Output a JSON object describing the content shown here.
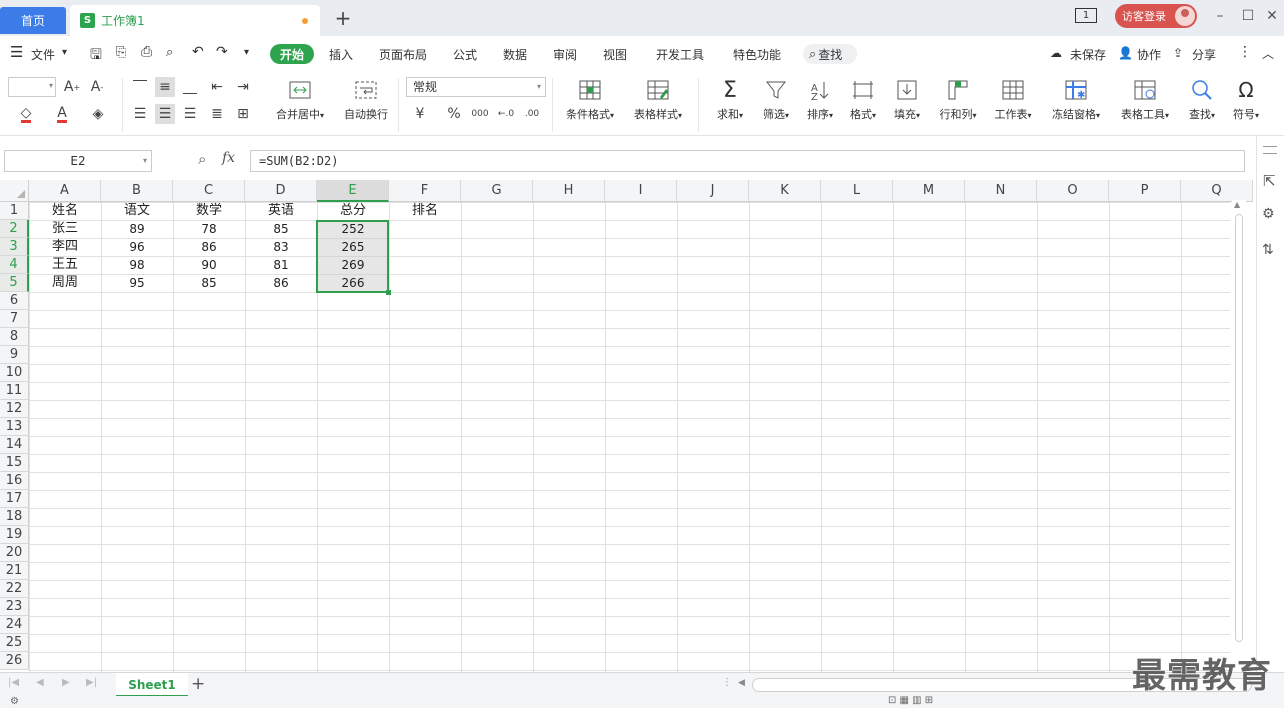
{
  "tabs": {
    "home": "首页",
    "doc_icon": "S",
    "doc_title": "工作簿1",
    "add": "+"
  },
  "titlebar": {
    "badge": "1",
    "login": "访客登录"
  },
  "menu": {
    "file": "文件",
    "items": [
      "开始",
      "插入",
      "页面布局",
      "公式",
      "数据",
      "审阅",
      "视图",
      "开发工具",
      "特色功能"
    ],
    "search": "查找",
    "unsaved": "未保存",
    "collab": "协作",
    "share": "分享"
  },
  "ribbon": {
    "merge": "合并居中",
    "autowrap": "自动换行",
    "format_select": "常规",
    "currency": "¥",
    "percent": "%",
    "thousands": "000",
    "cond_format": "条件格式",
    "table_style": "表格样式",
    "sum": "求和",
    "filter": "筛选",
    "sort": "排序",
    "format": "格式",
    "fill": "填充",
    "rowcol": "行和列",
    "sheet": "工作表",
    "freeze": "冻结窗格",
    "tabletools": "表格工具",
    "find": "查找",
    "symbol": "符号"
  },
  "formula": {
    "cell_ref": "E2",
    "fx": "fx",
    "content": "=SUM(B2:D2)"
  },
  "grid": {
    "columns": [
      "A",
      "B",
      "C",
      "D",
      "E",
      "F",
      "G",
      "H",
      "I",
      "J",
      "K",
      "L",
      "M",
      "N",
      "O",
      "P",
      "Q"
    ],
    "rows": [
      "1",
      "2",
      "3",
      "4",
      "5",
      "6",
      "7",
      "8",
      "9",
      "10",
      "11",
      "12",
      "13",
      "14",
      "15",
      "16",
      "17",
      "18",
      "19",
      "20",
      "21",
      "22",
      "23",
      "24",
      "25",
      "26"
    ],
    "selected_column": "E",
    "cells": [
      [
        "姓名",
        "语文",
        "数学",
        "英语",
        "总分",
        "排名"
      ],
      [
        "张三",
        "89",
        "78",
        "85",
        "252",
        ""
      ],
      [
        "李四",
        "96",
        "86",
        "83",
        "265",
        ""
      ],
      [
        "王五",
        "98",
        "90",
        "81",
        "269",
        ""
      ],
      [
        "周周",
        "95",
        "85",
        "86",
        "266",
        ""
      ]
    ]
  },
  "sheets": {
    "active": "Sheet1",
    "add": "+"
  },
  "watermark": "最需教育"
}
